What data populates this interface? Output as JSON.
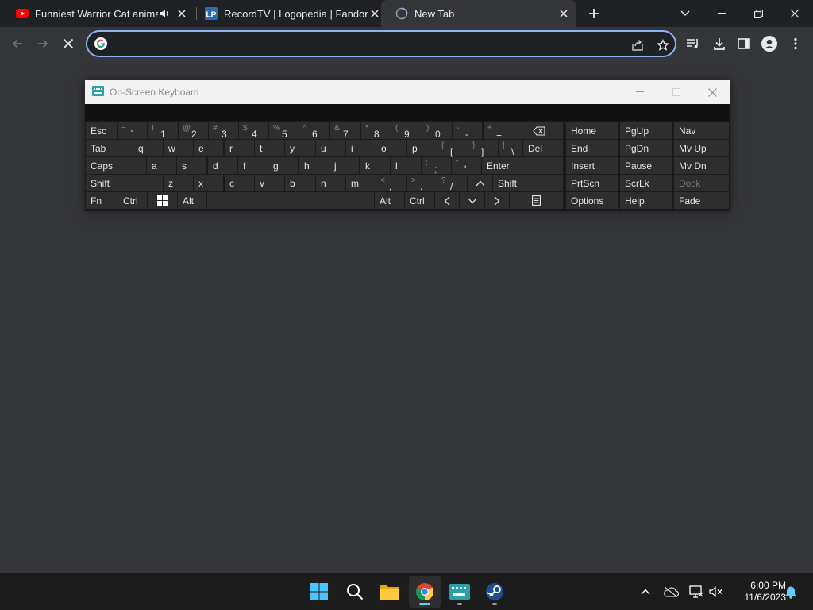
{
  "browser": {
    "tabs": [
      {
        "title": "Funniest Warrior Cat animati",
        "favicon": "youtube-icon",
        "audio": true,
        "active": false
      },
      {
        "title": "RecordTV | Logopedia | Fandom",
        "favicon": "logopedia-icon",
        "audio": false,
        "active": false
      },
      {
        "title": "New Tab",
        "favicon": "loading-globe-icon",
        "audio": false,
        "active": true
      }
    ],
    "logopedia_badge": "LP",
    "omnibox": {
      "value": "",
      "placeholder": ""
    },
    "colors": {
      "tabstrip": "#202124",
      "toolbar": "#35363a",
      "accent": "#8ab4f8"
    }
  },
  "osk": {
    "title": "On-Screen Keyboard",
    "rows": [
      [
        {
          "label": "Esc"
        },
        {
          "sup": "~",
          "sub": "`"
        },
        {
          "sup": "!",
          "sub": "1"
        },
        {
          "sup": "@",
          "sub": "2"
        },
        {
          "sup": "#",
          "sub": "3"
        },
        {
          "sup": "$",
          "sub": "4"
        },
        {
          "sup": "%",
          "sub": "5"
        },
        {
          "sup": "^",
          "sub": "6"
        },
        {
          "sup": "&",
          "sub": "7"
        },
        {
          "sup": "*",
          "sub": "8"
        },
        {
          "sup": "(",
          "sub": "9"
        },
        {
          "sup": ")",
          "sub": "0"
        },
        {
          "sup": "-",
          "sub": "-"
        },
        {
          "sup": "+",
          "sub": "="
        },
        {
          "icon": "backspace-icon"
        }
      ],
      [
        {
          "label": "Tab"
        },
        {
          "label": "q"
        },
        {
          "label": "w"
        },
        {
          "label": "e"
        },
        {
          "label": "r"
        },
        {
          "label": "t"
        },
        {
          "label": "y"
        },
        {
          "label": "u"
        },
        {
          "label": "i"
        },
        {
          "label": "o"
        },
        {
          "label": "p"
        },
        {
          "sup": "{",
          "sub": "["
        },
        {
          "sup": "}",
          "sub": "]"
        },
        {
          "sup": "|",
          "sub": "\\"
        },
        {
          "label": "Del"
        }
      ],
      [
        {
          "label": "Caps"
        },
        {
          "label": "a"
        },
        {
          "label": "s"
        },
        {
          "label": "d"
        },
        {
          "label": "f"
        },
        {
          "label": "g"
        },
        {
          "label": "h"
        },
        {
          "label": "j"
        },
        {
          "label": "k"
        },
        {
          "label": "l"
        },
        {
          "sup": ":",
          "sub": ";"
        },
        {
          "sup": "\"",
          "sub": "'"
        },
        {
          "label": "Enter"
        }
      ],
      [
        {
          "label": "Shift"
        },
        {
          "label": "z"
        },
        {
          "label": "x"
        },
        {
          "label": "c"
        },
        {
          "label": "v"
        },
        {
          "label": "b"
        },
        {
          "label": "n"
        },
        {
          "label": "m"
        },
        {
          "sup": "<",
          "sub": ","
        },
        {
          "sup": ">",
          "sub": "."
        },
        {
          "sup": "?",
          "sub": "/"
        },
        {
          "icon": "arrow-up-icon"
        },
        {
          "label": "Shift"
        }
      ],
      [
        {
          "label": "Fn"
        },
        {
          "label": "Ctrl"
        },
        {
          "icon": "windows-icon"
        },
        {
          "label": "Alt"
        },
        {
          "label": ""
        },
        {
          "label": "Alt"
        },
        {
          "label": "Ctrl"
        },
        {
          "icon": "arrow-left-icon"
        },
        {
          "icon": "arrow-down-icon"
        },
        {
          "icon": "arrow-right-icon"
        },
        {
          "icon": "context-menu-icon"
        }
      ]
    ],
    "side": [
      [
        "Home",
        "PgUp",
        "Nav"
      ],
      [
        "End",
        "PgDn",
        "Mv Up"
      ],
      [
        "Insert",
        "Pause",
        "Mv Dn"
      ],
      [
        "PrtScn",
        "ScrLk",
        "Dock"
      ],
      [
        "Options",
        "Help",
        "Fade"
      ]
    ],
    "dimmed_side": [
      "Dock"
    ]
  },
  "taskbar": {
    "apps": [
      {
        "name": "start-button",
        "icon": "windows-start-icon"
      },
      {
        "name": "search-button",
        "icon": "search-icon"
      },
      {
        "name": "file-explorer",
        "icon": "folder-icon"
      },
      {
        "name": "chrome",
        "icon": "chrome-icon",
        "active": true
      },
      {
        "name": "on-screen-keyboard",
        "icon": "keyboard-icon",
        "running": true
      },
      {
        "name": "steam",
        "icon": "steam-icon",
        "running": true
      }
    ],
    "clock": {
      "time": "6:00 PM",
      "date": "11/6/2023"
    }
  }
}
